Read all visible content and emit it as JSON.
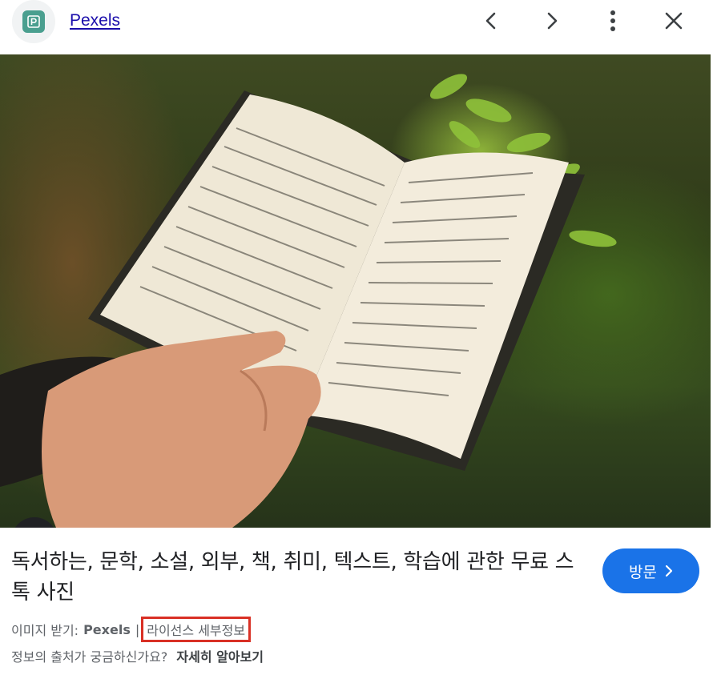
{
  "header": {
    "site_name": "Pexels",
    "favicon_icon": "pexels-logo-icon",
    "nav": {
      "prev_icon": "chevron-left-icon",
      "next_icon": "chevron-right-icon",
      "more_icon": "more-vert-icon",
      "close_icon": "close-icon"
    }
  },
  "image": {
    "lens_icon": "google-lens-icon"
  },
  "details": {
    "title": "독서하는, 문학, 소설, 외부, 책, 취미, 텍스트, 학습에 관한 무료 스톡 사진",
    "visit_label": "방문",
    "source_prefix": "이미지 받기:",
    "source_name": "Pexels",
    "separator": "|",
    "license_label": "라이선스 세부정보",
    "info_question": "정보의 출처가 궁금하신가요?",
    "learn_more_label": "자세히 알아보기"
  },
  "colors": {
    "accent": "#1a73e8",
    "highlight_box": "#d93025",
    "favicon": "#4a9f8f"
  }
}
